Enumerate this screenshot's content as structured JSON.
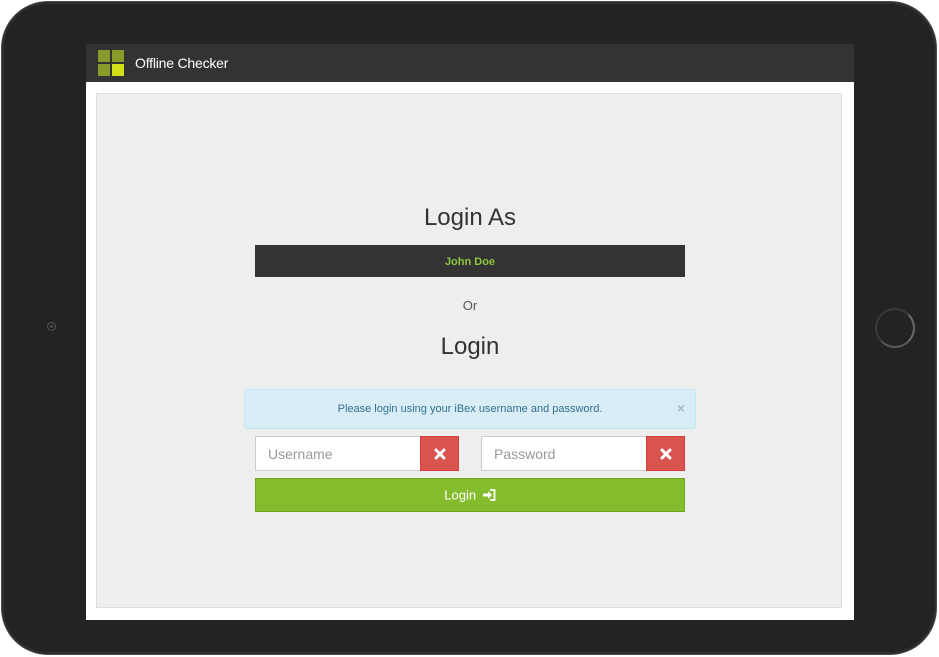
{
  "navbar": {
    "app_title": "Offline Checker",
    "logo_icon": "app-logo-grid"
  },
  "main": {
    "login_as_heading": "Login As",
    "user_button_label": "John Doe",
    "or_text": "Or",
    "login_heading": "Login",
    "alert": {
      "message": "Please login using your iBex username and password.",
      "close_glyph": "×"
    },
    "username": {
      "placeholder": "Username",
      "value": "",
      "clear_icon": "times-icon"
    },
    "password": {
      "placeholder": "Password",
      "value": "",
      "clear_icon": "times-icon"
    },
    "login_button_label": "Login",
    "login_button_icon": "sign-in-icon"
  },
  "colors": {
    "navbar": "#333333",
    "accent_green": "#85bc2e",
    "user_name_green": "#8dc63f",
    "danger_red": "#d9534f",
    "alert_bg": "#d9edf7",
    "alert_text": "#31708f",
    "content_bg": "#eeeeee",
    "device_frame": "#232323"
  }
}
